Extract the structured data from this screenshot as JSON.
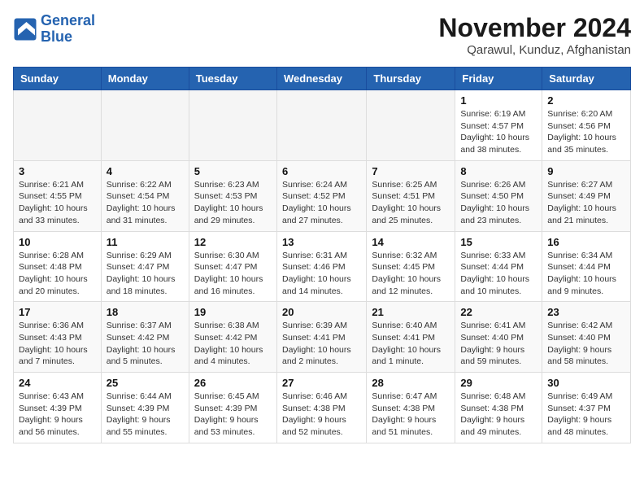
{
  "header": {
    "logo_line1": "General",
    "logo_line2": "Blue",
    "month": "November 2024",
    "location": "Qarawul, Kunduz, Afghanistan"
  },
  "weekdays": [
    "Sunday",
    "Monday",
    "Tuesday",
    "Wednesday",
    "Thursday",
    "Friday",
    "Saturday"
  ],
  "weeks": [
    [
      {
        "day": "",
        "info": ""
      },
      {
        "day": "",
        "info": ""
      },
      {
        "day": "",
        "info": ""
      },
      {
        "day": "",
        "info": ""
      },
      {
        "day": "",
        "info": ""
      },
      {
        "day": "1",
        "info": "Sunrise: 6:19 AM\nSunset: 4:57 PM\nDaylight: 10 hours and 38 minutes."
      },
      {
        "day": "2",
        "info": "Sunrise: 6:20 AM\nSunset: 4:56 PM\nDaylight: 10 hours and 35 minutes."
      }
    ],
    [
      {
        "day": "3",
        "info": "Sunrise: 6:21 AM\nSunset: 4:55 PM\nDaylight: 10 hours and 33 minutes."
      },
      {
        "day": "4",
        "info": "Sunrise: 6:22 AM\nSunset: 4:54 PM\nDaylight: 10 hours and 31 minutes."
      },
      {
        "day": "5",
        "info": "Sunrise: 6:23 AM\nSunset: 4:53 PM\nDaylight: 10 hours and 29 minutes."
      },
      {
        "day": "6",
        "info": "Sunrise: 6:24 AM\nSunset: 4:52 PM\nDaylight: 10 hours and 27 minutes."
      },
      {
        "day": "7",
        "info": "Sunrise: 6:25 AM\nSunset: 4:51 PM\nDaylight: 10 hours and 25 minutes."
      },
      {
        "day": "8",
        "info": "Sunrise: 6:26 AM\nSunset: 4:50 PM\nDaylight: 10 hours and 23 minutes."
      },
      {
        "day": "9",
        "info": "Sunrise: 6:27 AM\nSunset: 4:49 PM\nDaylight: 10 hours and 21 minutes."
      }
    ],
    [
      {
        "day": "10",
        "info": "Sunrise: 6:28 AM\nSunset: 4:48 PM\nDaylight: 10 hours and 20 minutes."
      },
      {
        "day": "11",
        "info": "Sunrise: 6:29 AM\nSunset: 4:47 PM\nDaylight: 10 hours and 18 minutes."
      },
      {
        "day": "12",
        "info": "Sunrise: 6:30 AM\nSunset: 4:47 PM\nDaylight: 10 hours and 16 minutes."
      },
      {
        "day": "13",
        "info": "Sunrise: 6:31 AM\nSunset: 4:46 PM\nDaylight: 10 hours and 14 minutes."
      },
      {
        "day": "14",
        "info": "Sunrise: 6:32 AM\nSunset: 4:45 PM\nDaylight: 10 hours and 12 minutes."
      },
      {
        "day": "15",
        "info": "Sunrise: 6:33 AM\nSunset: 4:44 PM\nDaylight: 10 hours and 10 minutes."
      },
      {
        "day": "16",
        "info": "Sunrise: 6:34 AM\nSunset: 4:44 PM\nDaylight: 10 hours and 9 minutes."
      }
    ],
    [
      {
        "day": "17",
        "info": "Sunrise: 6:36 AM\nSunset: 4:43 PM\nDaylight: 10 hours and 7 minutes."
      },
      {
        "day": "18",
        "info": "Sunrise: 6:37 AM\nSunset: 4:42 PM\nDaylight: 10 hours and 5 minutes."
      },
      {
        "day": "19",
        "info": "Sunrise: 6:38 AM\nSunset: 4:42 PM\nDaylight: 10 hours and 4 minutes."
      },
      {
        "day": "20",
        "info": "Sunrise: 6:39 AM\nSunset: 4:41 PM\nDaylight: 10 hours and 2 minutes."
      },
      {
        "day": "21",
        "info": "Sunrise: 6:40 AM\nSunset: 4:41 PM\nDaylight: 10 hours and 1 minute."
      },
      {
        "day": "22",
        "info": "Sunrise: 6:41 AM\nSunset: 4:40 PM\nDaylight: 9 hours and 59 minutes."
      },
      {
        "day": "23",
        "info": "Sunrise: 6:42 AM\nSunset: 4:40 PM\nDaylight: 9 hours and 58 minutes."
      }
    ],
    [
      {
        "day": "24",
        "info": "Sunrise: 6:43 AM\nSunset: 4:39 PM\nDaylight: 9 hours and 56 minutes."
      },
      {
        "day": "25",
        "info": "Sunrise: 6:44 AM\nSunset: 4:39 PM\nDaylight: 9 hours and 55 minutes."
      },
      {
        "day": "26",
        "info": "Sunrise: 6:45 AM\nSunset: 4:39 PM\nDaylight: 9 hours and 53 minutes."
      },
      {
        "day": "27",
        "info": "Sunrise: 6:46 AM\nSunset: 4:38 PM\nDaylight: 9 hours and 52 minutes."
      },
      {
        "day": "28",
        "info": "Sunrise: 6:47 AM\nSunset: 4:38 PM\nDaylight: 9 hours and 51 minutes."
      },
      {
        "day": "29",
        "info": "Sunrise: 6:48 AM\nSunset: 4:38 PM\nDaylight: 9 hours and 49 minutes."
      },
      {
        "day": "30",
        "info": "Sunrise: 6:49 AM\nSunset: 4:37 PM\nDaylight: 9 hours and 48 minutes."
      }
    ]
  ]
}
